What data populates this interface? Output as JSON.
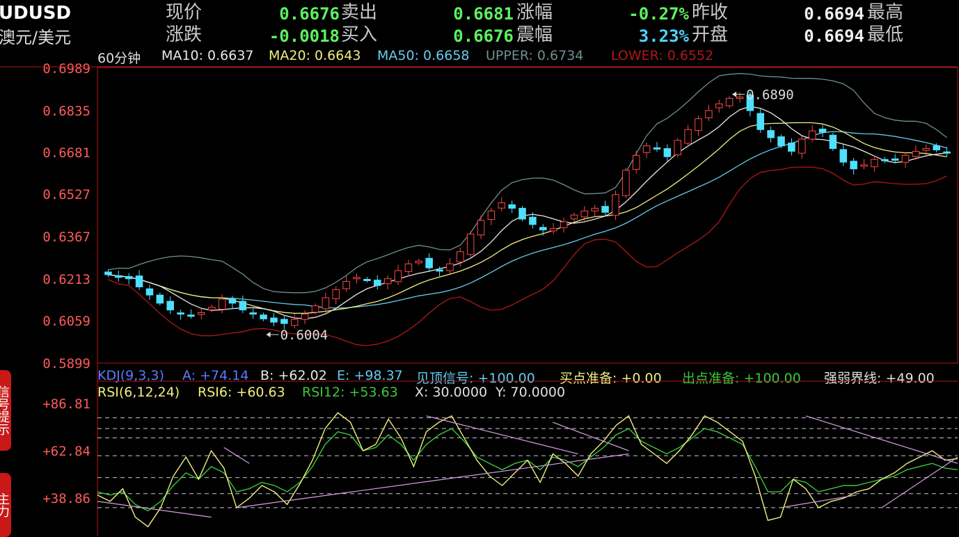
{
  "header": {
    "symbol": "UDUSD",
    "pair_cn": "澳元/美元",
    "quotes": [
      {
        "label": "现价",
        "value": "0.6676",
        "color": "#5ef05e"
      },
      {
        "label": "卖出",
        "value": "0.6681",
        "color": "#5ef05e"
      },
      {
        "label": "涨幅",
        "value": "-0.27%",
        "color": "#5ef05e"
      },
      {
        "label": "昨收",
        "value": "0.6694",
        "color": "#f0f0f0"
      },
      {
        "label": "最高",
        "value": "",
        "color": "#f0f0f0"
      },
      {
        "label": "涨跌",
        "value": "-0.0018",
        "color": "#5ef05e"
      },
      {
        "label": "买入",
        "value": "0.6676",
        "color": "#5ef05e"
      },
      {
        "label": "震幅",
        "value": "3.23%",
        "color": "#4fd2ff"
      },
      {
        "label": "开盘",
        "value": "0.6694",
        "color": "#f0f0f0"
      },
      {
        "label": "最低",
        "value": "",
        "color": "#f0f0f0"
      }
    ]
  },
  "side_tabs": [
    "信号提示",
    "主力"
  ],
  "indicators_main": {
    "period": "60分钟",
    "ma10": "MA10: 0.6637",
    "ma20": "MA20: 0.6643",
    "ma50": "MA50: 0.6658",
    "upper": "UPPER: 0.6734",
    "lower": "LOWER: 0.6552",
    "colors": {
      "ma10": "#e8e8e8",
      "ma20": "#f0f080",
      "ma50": "#66ccee",
      "upper": "#6f8f8f",
      "lower": "#b01818"
    }
  },
  "indicators_sub": {
    "kdj_title": "KDJ(9,3,3)",
    "kdj_a": "A: +74.14",
    "kdj_b": "B: +62.02",
    "kdj_e": "E: +98.37",
    "sig1": "见顶信号: +100.00",
    "sig2": "买点准备: +0.00",
    "sig3": "出点准备: +100.00",
    "sig4": "强弱界线: +49.00",
    "rsi_title": "RSI(6,12,24)",
    "rsi6": "RSI6: +60.63",
    "rsi12": "RSI12: +53.63",
    "x": "X: 30.0000",
    "y": "Y: 70.0000"
  },
  "chart_data": [
    {
      "type": "candlestick",
      "title": "",
      "ylim": [
        0.5899,
        0.6989
      ],
      "y_ticks": [
        "0.6989",
        "0.6835",
        "0.6681",
        "0.6527",
        "0.6367",
        "0.6213",
        "0.6059",
        "0.5899"
      ],
      "annotations": [
        {
          "text": "0.6890",
          "index": 60,
          "value": 0.689
        },
        {
          "text": "0.6004",
          "index": 15,
          "value": 0.6004
        }
      ],
      "series": [
        {
          "name": "MA10",
          "color": "#e8e8e8"
        },
        {
          "name": "MA20",
          "color": "#f0f080"
        },
        {
          "name": "MA50",
          "color": "#66ccee"
        },
        {
          "name": "UPPER",
          "color": "#6f8f8f"
        },
        {
          "name": "LOWER",
          "color": "#b01818"
        }
      ],
      "closes": [
        0.6225,
        0.6215,
        0.621,
        0.618,
        0.615,
        0.612,
        0.6095,
        0.608,
        0.6075,
        0.6085,
        0.6105,
        0.6135,
        0.612,
        0.6095,
        0.608,
        0.6062,
        0.605,
        0.6045,
        0.606,
        0.608,
        0.611,
        0.614,
        0.617,
        0.62,
        0.6215,
        0.6205,
        0.6185,
        0.621,
        0.624,
        0.6265,
        0.6275,
        0.625,
        0.624,
        0.6265,
        0.631,
        0.6375,
        0.6425,
        0.646,
        0.649,
        0.647,
        0.643,
        0.641,
        0.639,
        0.6395,
        0.642,
        0.6445,
        0.646,
        0.647,
        0.6455,
        0.652,
        0.661,
        0.6665,
        0.67,
        0.669,
        0.666,
        0.672,
        0.676,
        0.68,
        0.683,
        0.6855,
        0.6875,
        0.688,
        0.683,
        0.676,
        0.673,
        0.67,
        0.668,
        0.6725,
        0.6755,
        0.675,
        0.669,
        0.664,
        0.6615,
        0.663,
        0.665,
        0.6645,
        0.665,
        0.6665,
        0.668,
        0.669,
        0.6685,
        0.6676
      ]
    },
    {
      "type": "line",
      "title": "",
      "y_ticks": [
        "+86.81",
        "+62.84",
        "+38.86"
      ],
      "dashed_levels": [
        86.81,
        80,
        74.14,
        62.84,
        49,
        38.86,
        30
      ],
      "series": [
        {
          "name": "RSI6",
          "color": "#f0f080",
          "values": [
            38,
            34,
            42,
            24,
            18,
            30,
            50,
            62,
            48,
            66,
            55,
            30,
            36,
            44,
            40,
            32,
            45,
            60,
            80,
            90,
            84,
            66,
            70,
            86,
            74,
            56,
            78,
            84,
            88,
            74,
            60,
            50,
            44,
            52,
            60,
            46,
            64,
            58,
            50,
            64,
            72,
            82,
            88,
            70,
            64,
            58,
            66,
            76,
            88,
            84,
            78,
            72,
            50,
            22,
            24,
            48,
            42,
            30,
            34,
            36,
            40,
            42,
            48,
            52,
            58,
            62,
            66,
            60,
            61
          ]
        },
        {
          "name": "RSI12",
          "color": "#3cc83c",
          "values": [
            40,
            38,
            40,
            32,
            28,
            34,
            44,
            52,
            48,
            56,
            52,
            40,
            42,
            46,
            44,
            40,
            46,
            56,
            70,
            78,
            76,
            66,
            68,
            76,
            70,
            60,
            70,
            76,
            80,
            72,
            62,
            58,
            54,
            58,
            60,
            54,
            62,
            60,
            56,
            62,
            68,
            76,
            80,
            72,
            68,
            64,
            68,
            74,
            80,
            78,
            74,
            70,
            56,
            40,
            40,
            48,
            46,
            40,
            42,
            44,
            44,
            46,
            48,
            50,
            54,
            56,
            58,
            55,
            54
          ]
        }
      ]
    }
  ]
}
